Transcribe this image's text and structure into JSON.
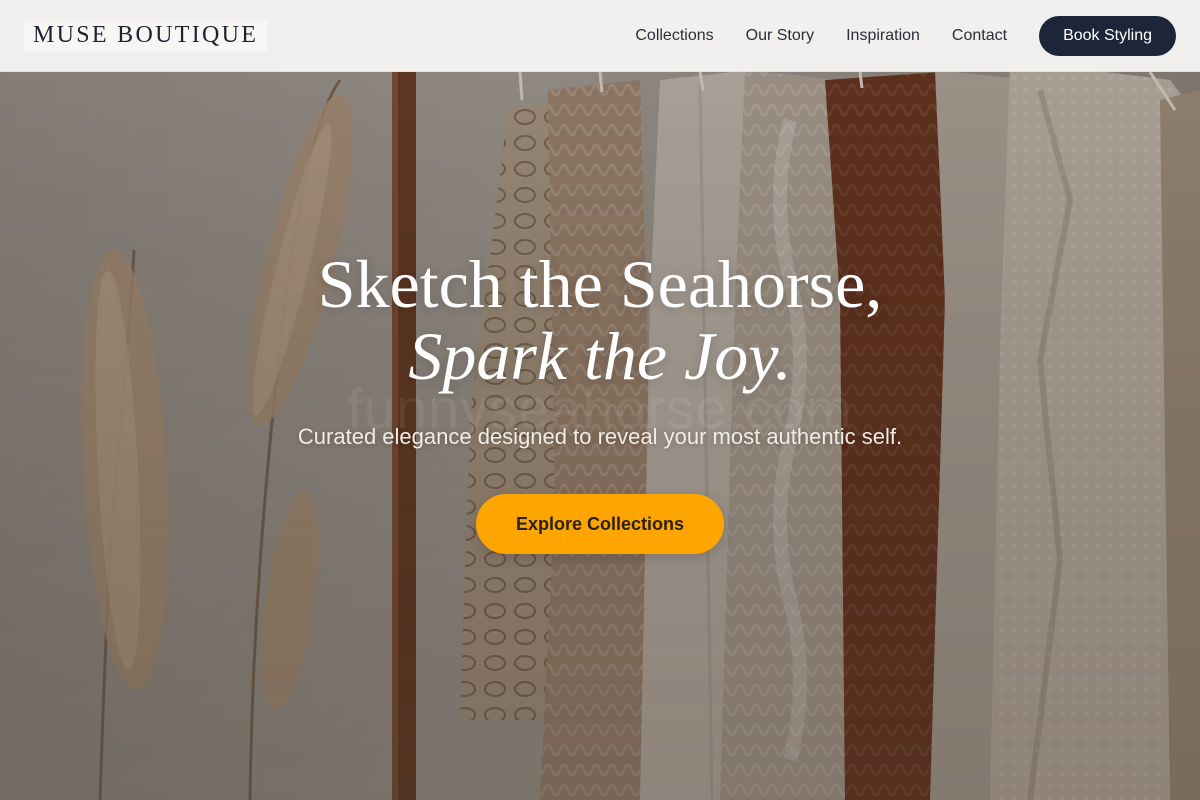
{
  "brand": {
    "logo_text": "MUSE BOUTIQUE"
  },
  "nav": {
    "items": [
      {
        "label": "Collections"
      },
      {
        "label": "Our Story"
      },
      {
        "label": "Inspiration"
      },
      {
        "label": "Contact"
      }
    ],
    "cta_label": "Book Styling"
  },
  "hero": {
    "headline_line1": "Sketch the Seahorse,",
    "headline_line2": "Spark the Joy.",
    "watermark": "funnyseahorse.com",
    "subtitle": "Curated elegance designed to reveal your most authentic self.",
    "cta_label": "Explore Collections"
  },
  "colors": {
    "nav_cta_bg": "#1d2639",
    "hero_cta_bg": "#ffa500",
    "header_bg": "#f8f7f5",
    "text_dark": "#1e2330"
  }
}
